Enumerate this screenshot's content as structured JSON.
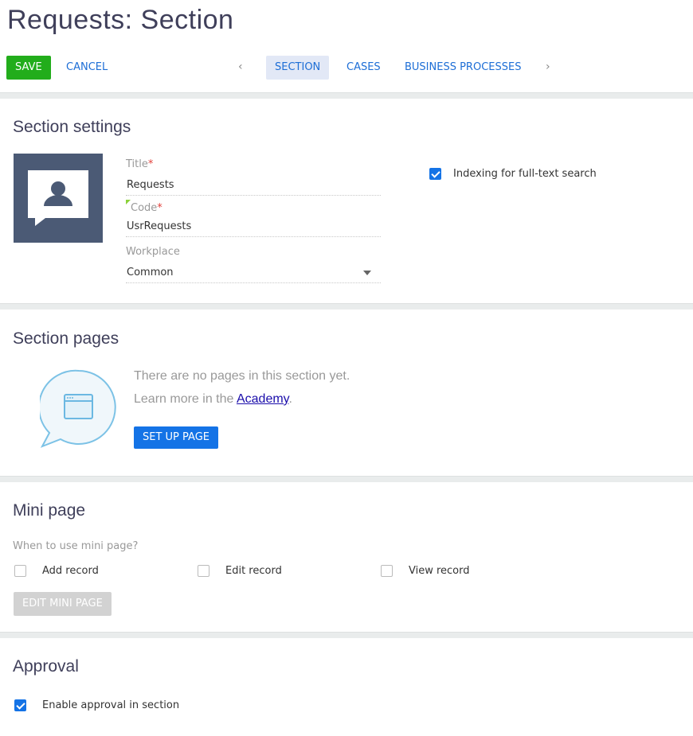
{
  "header": {
    "title": "Requests: Section",
    "save": "Save",
    "cancel": "Cancel",
    "tabs": [
      {
        "label": "Section",
        "active": true
      },
      {
        "label": "Cases"
      },
      {
        "label": "Business processes"
      }
    ],
    "prev": "‹",
    "next": "›"
  },
  "settings": {
    "title": "Section settings",
    "title_label": "Title",
    "title_value": "Requests",
    "code_label": "Code",
    "code_value": "UsrRequests",
    "workplace_label": "Workplace",
    "workplace_value": "Common",
    "required_mark": "*",
    "indexing_label": "Indexing for full-text search",
    "indexing_checked": true,
    "icon": "user-chat-icon"
  },
  "pages": {
    "title": "Section pages",
    "empty_text": "There are no pages in this section yet.",
    "learn_prefix": "Learn more in the ",
    "academy_link": "Academy",
    "learn_suffix": ".",
    "setup_button": "Set up page"
  },
  "mini": {
    "title": "Mini page",
    "question": "When to use mini page?",
    "options": [
      {
        "label": "Add record",
        "checked": false
      },
      {
        "label": "Edit record",
        "checked": false
      },
      {
        "label": "View record",
        "checked": false
      }
    ],
    "edit_button": "Edit mini page"
  },
  "approval": {
    "title": "Approval",
    "enable_label": "Enable approval in section",
    "enable_checked": true
  },
  "colors": {
    "save": "#22ad1b",
    "primary": "#1473e6",
    "link": "#1d6ed6",
    "icon_bg": "#4b5a75"
  }
}
